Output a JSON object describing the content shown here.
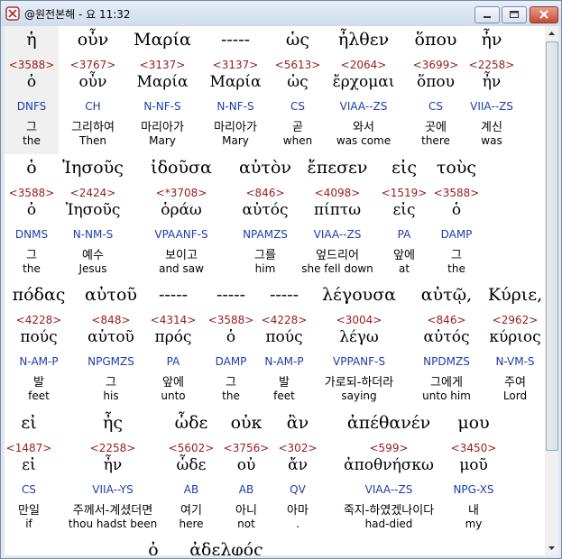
{
  "window": {
    "title": "@원전본해 - 요 11:32",
    "icons": [
      "app-icon",
      "minimize-icon",
      "maximize-icon",
      "close-icon",
      "scroll-up-icon",
      "scroll-down-icon"
    ]
  },
  "rows": [
    {
      "words": [
        {
          "greek": "ἡ",
          "strong": "<3588>",
          "lexeme": "ὁ",
          "morph": "DNFS",
          "korean": "그",
          "english": "the"
        },
        {
          "greek": "οὖν",
          "strong": "<3767>",
          "lexeme": "οὖν",
          "morph": "CH",
          "korean": "그리하여",
          "english": "Then"
        },
        {
          "greek": "Μαρία",
          "strong": "<3137>",
          "lexeme": "Μαρία",
          "morph": "N-NF-S",
          "korean": "마리아가",
          "english": "Mary"
        },
        {
          "greek": "-----",
          "strong": "<3137>",
          "lexeme": "Μαρία",
          "morph": "N-NF-S",
          "korean": "마리아가",
          "english": "Mary"
        },
        {
          "greek": "ὡς",
          "strong": "<5613>",
          "lexeme": "ὡς",
          "morph": "CS",
          "korean": "곧",
          "english": "when"
        },
        {
          "greek": "ἦλθεν",
          "strong": "<2064>",
          "lexeme": "ἔρχομαι",
          "morph": "VIAA--ZS",
          "korean": "와서",
          "english": "was come"
        },
        {
          "greek": "ὅπου",
          "strong": "<3699>",
          "lexeme": "ὅπου",
          "morph": "CS",
          "korean": "곳에",
          "english": "there"
        },
        {
          "greek": "ἦν",
          "strong": "<2258>",
          "lexeme": "ἦν",
          "morph": "VIIA--ZS",
          "korean": "계신",
          "english": "was"
        }
      ]
    },
    {
      "words": [
        {
          "greek": "ὁ",
          "strong": "<3588>",
          "lexeme": "ὁ",
          "morph": "DNMS",
          "korean": "그",
          "english": "the"
        },
        {
          "greek": "Ἰησοῦς",
          "strong": "<2424>",
          "lexeme": "Ἰησοῦς",
          "morph": "N-NM-S",
          "korean": "예수",
          "english": "Jesus"
        },
        {
          "greek": "ἰδοῦσα",
          "strong": "<*3708>",
          "lexeme": "ὁράω",
          "morph": "VPAANF-S",
          "korean": "보이고",
          "english": "and saw"
        },
        {
          "greek": "αὐτὸν",
          "strong": "<846>",
          "lexeme": "αὐτός",
          "morph": "NPAMZS",
          "korean": "그를",
          "english": "him"
        },
        {
          "greek": "ἔπεσεν",
          "strong": "<4098>",
          "lexeme": "πίπτω",
          "morph": "VIAA--ZS",
          "korean": "엎드리어",
          "english": "she fell down"
        },
        {
          "greek": "εἰς",
          "strong": "<1519>",
          "lexeme": "εἰς",
          "morph": "PA",
          "korean": "앞에",
          "english": "at"
        },
        {
          "greek": "τοὺς",
          "strong": "<3588>",
          "lexeme": "ὁ",
          "morph": "DAMP",
          "korean": "그",
          "english": "the"
        }
      ]
    },
    {
      "words": [
        {
          "greek": "πόδας",
          "strong": "<4228>",
          "lexeme": "πούς",
          "morph": "N-AM-P",
          "korean": "발",
          "english": "feet"
        },
        {
          "greek": "αὐτοῦ",
          "strong": "<848>",
          "lexeme": "αὑτοῦ",
          "morph": "NPGMZS",
          "korean": "그",
          "english": "his"
        },
        {
          "greek": "-----",
          "strong": "<4314>",
          "lexeme": "πρός",
          "morph": "PA",
          "korean": "앞에",
          "english": "unto"
        },
        {
          "greek": "-----",
          "strong": "<3588>",
          "lexeme": "ὁ",
          "morph": "DAMP",
          "korean": "그",
          "english": "the"
        },
        {
          "greek": "-----",
          "strong": "<4228>",
          "lexeme": "πούς",
          "morph": "N-AM-P",
          "korean": "발",
          "english": "feet"
        },
        {
          "greek": "λέγουσα",
          "strong": "<3004>",
          "lexeme": "λέγω",
          "morph": "VPPANF-S",
          "korean": "가로되-하더라",
          "english": "saying"
        },
        {
          "greek": "αὐτῷ,",
          "strong": "<846>",
          "lexeme": "αὐτός",
          "morph": "NPDMZS",
          "korean": "그에게",
          "english": "unto him"
        },
        {
          "greek": "Κύριε,",
          "strong": "<2962>",
          "lexeme": "κύριος",
          "morph": "N-VM-S",
          "korean": "주여",
          "english": "Lord"
        }
      ]
    },
    {
      "words": [
        {
          "greek": "εἰ",
          "strong": "<1487>",
          "lexeme": "εἰ",
          "morph": "CS",
          "korean": "만일",
          "english": "if"
        },
        {
          "greek": "ἦς",
          "strong": "<2258>",
          "lexeme": "ἦν",
          "morph": "VIIA--YS",
          "korean": "주께서-계셨더면",
          "english": "thou hadst been"
        },
        {
          "greek": "ὧδε",
          "strong": "<5602>",
          "lexeme": "ὧδε",
          "morph": "AB",
          "korean": "여기",
          "english": "here"
        },
        {
          "greek": "οὐκ",
          "strong": "<3756>",
          "lexeme": "οὐ",
          "morph": "AB",
          "korean": "아니",
          "english": "not"
        },
        {
          "greek": "ἂν",
          "strong": "<302>",
          "lexeme": "ἄν",
          "morph": "QV",
          "korean": "아마",
          "english": "."
        },
        {
          "greek": "ἀπέθανέν",
          "strong": "<599>",
          "lexeme": "ἀποθνήσκω",
          "morph": "VIAA--ZS",
          "korean": "죽지-하였겠나이다",
          "english": "had-died"
        },
        {
          "greek": "μου",
          "strong": "<3450>",
          "lexeme": "μοῦ",
          "morph": "NPG-XS",
          "korean": "내",
          "english": "my"
        }
      ]
    },
    {
      "words": [
        {
          "greek": "ὁ",
          "strong": "",
          "lexeme": "",
          "morph": "",
          "korean": "",
          "english": ""
        },
        {
          "greek": "ἀδελφός",
          "strong": "",
          "lexeme": "",
          "morph": "",
          "korean": "",
          "english": ""
        }
      ]
    }
  ]
}
